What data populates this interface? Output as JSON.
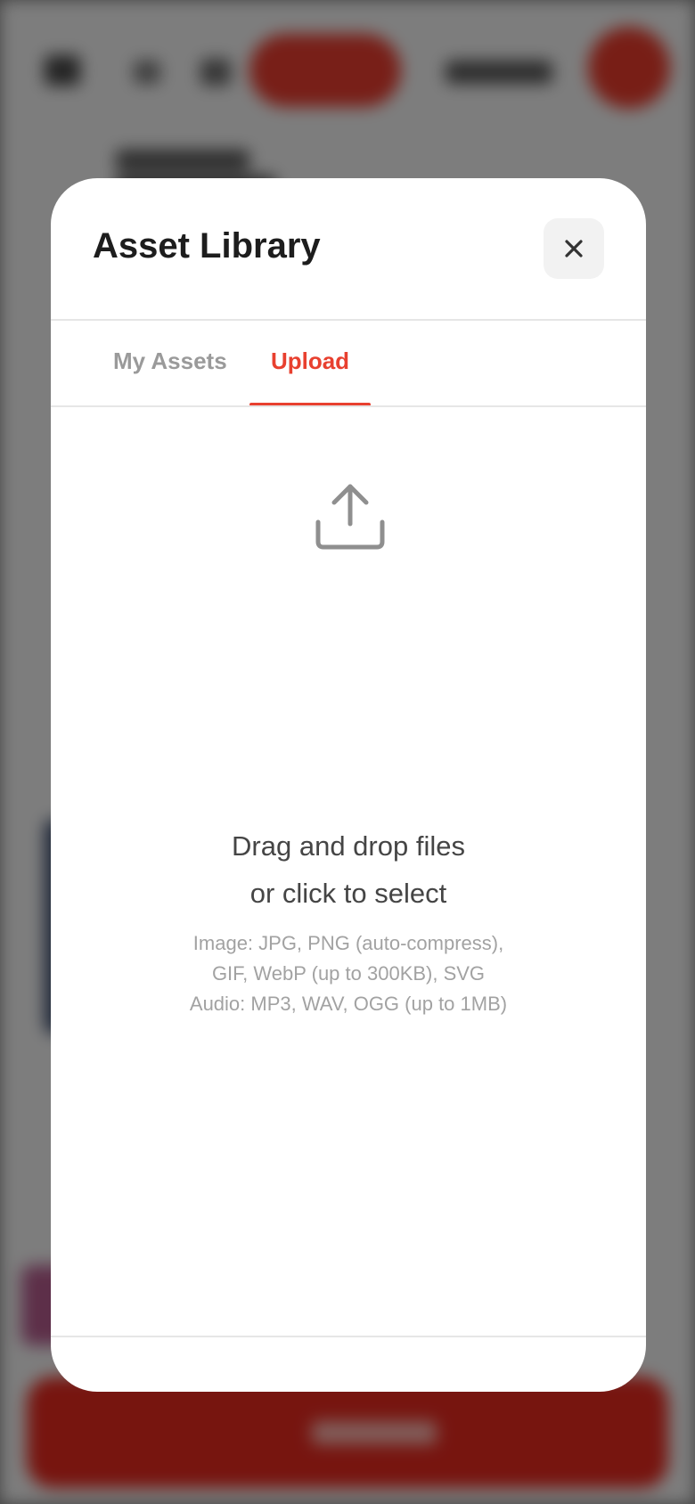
{
  "modal": {
    "title": "Asset Library",
    "close_label": "Close"
  },
  "tabs": [
    {
      "label": "My Assets",
      "active": false
    },
    {
      "label": "Upload",
      "active": true
    }
  ],
  "upload": {
    "icon": "upload-icon",
    "line1": "Drag and drop files",
    "line2": "or click to select",
    "hint_lines": [
      "Image: JPG, PNG (auto-compress),",
      "GIF, WebP (up to 300KB), SVG",
      "Audio: MP3, WAV, OGG (up to 1MB)"
    ]
  },
  "colors": {
    "accent": "#e8402f",
    "tab_inactive": "#9a9a9a",
    "title": "#1d1d1d"
  }
}
